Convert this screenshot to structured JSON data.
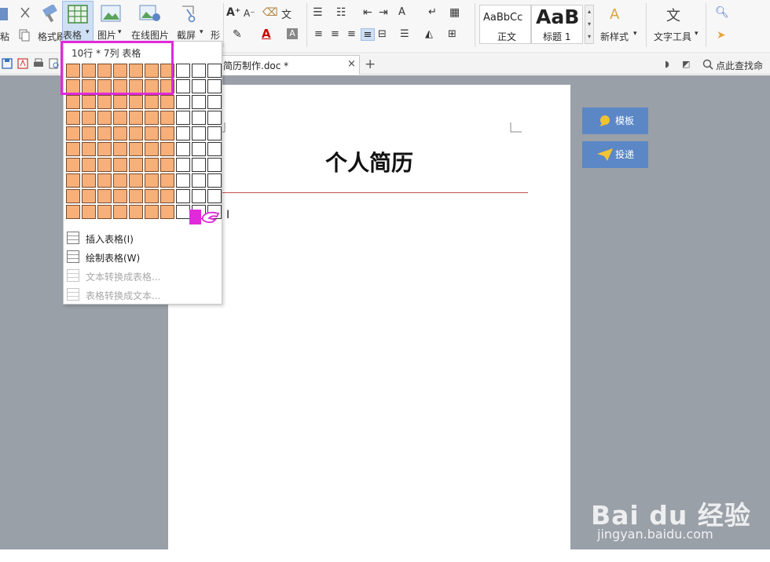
{
  "ribbon": {
    "paste_label": "粘",
    "format_painter_label": "格式刷",
    "table_label": "表格",
    "picture_label": "图片",
    "online_picture_label": "在线图片",
    "screenshot_label": "截屏",
    "shape_label": "形",
    "styles": {
      "normal_preview": "AaBbCc",
      "normal_label": "正文",
      "heading_preview": "AaB",
      "heading_label": "标题 1"
    },
    "new_style_label": "新样式",
    "text_tools_label": "文字工具"
  },
  "toolbar2": {
    "doc_tab_title": "简历制作.doc *",
    "close_glyph": "×",
    "new_tab_glyph": "+",
    "search_placeholder": "点此查找命"
  },
  "table_popup": {
    "title": "10行 * 7列 表格",
    "rows_selected": 10,
    "cols_selected": 7,
    "grid_rows": 10,
    "grid_cols": 10,
    "menu": [
      {
        "label": "插入表格(I)",
        "enabled": true,
        "icon": "insert-table-icon"
      },
      {
        "label": "绘制表格(W)",
        "enabled": true,
        "icon": "draw-table-icon"
      },
      {
        "label": "文本转换成表格...",
        "enabled": false,
        "icon": "text-to-table-icon"
      },
      {
        "label": "表格转换成文本...",
        "enabled": false,
        "icon": "table-to-text-icon"
      }
    ]
  },
  "document": {
    "heading": "个人简历",
    "cursor_glyph": "I"
  },
  "side_panel": {
    "template_label": "模板",
    "submit_label": "投递"
  },
  "watermark": {
    "brand": "Bai du 经验",
    "url": "jingyan.baidu.com"
  },
  "colors": {
    "selected_cell": "#f7b07a",
    "highlight": "#e02ad9",
    "side_button": "#5b87c6",
    "heading_rule": "#c0504d"
  }
}
